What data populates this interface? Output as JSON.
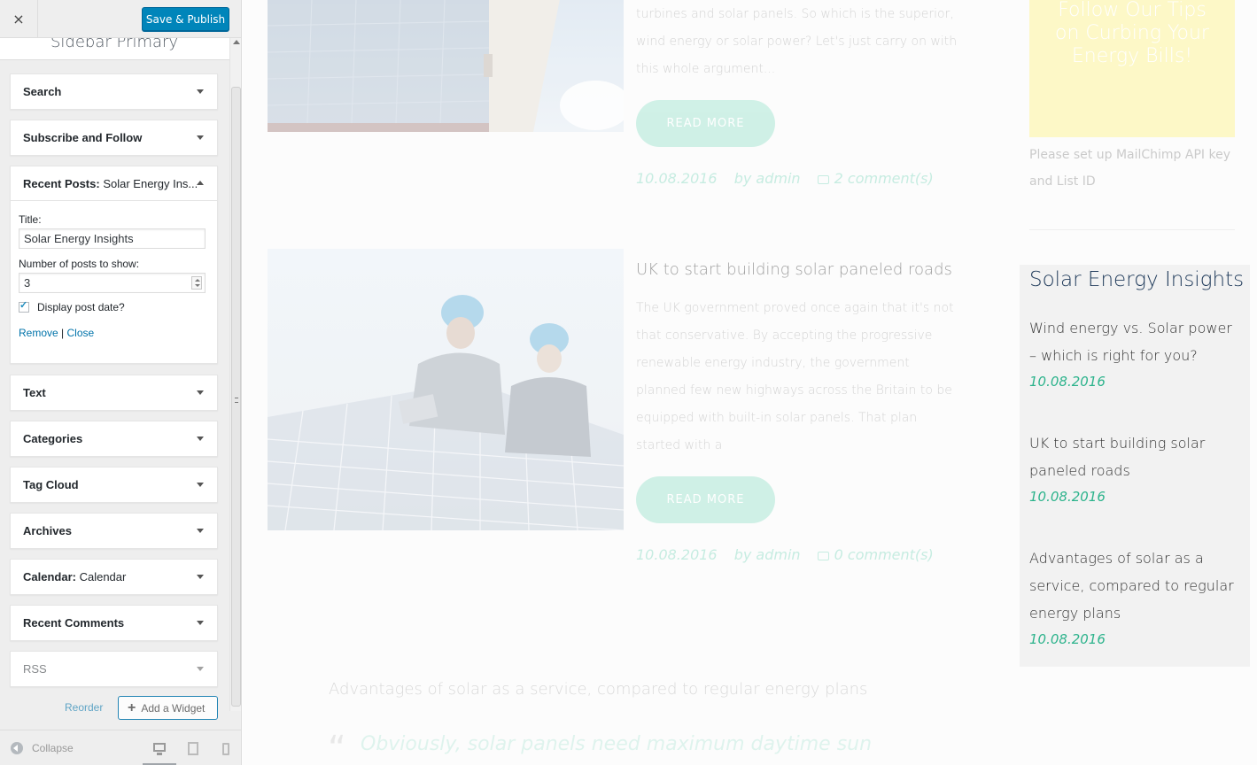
{
  "customizer": {
    "close_label": "×",
    "publish_label": "Save & Publish",
    "section_title": "Sidebar Primary",
    "widgets": [
      {
        "title": "Search",
        "subtitle": ""
      },
      {
        "title": "Subscribe and Follow",
        "subtitle": ""
      },
      {
        "title": "Recent Posts:",
        "subtitle": "Solar Energy Ins..."
      },
      {
        "title": "Text",
        "subtitle": ""
      },
      {
        "title": "Categories",
        "subtitle": ""
      },
      {
        "title": "Tag Cloud",
        "subtitle": ""
      },
      {
        "title": "Archives",
        "subtitle": ""
      },
      {
        "title": "Calendar:",
        "subtitle": "Calendar"
      },
      {
        "title": "Recent Comments",
        "subtitle": ""
      },
      {
        "title": "RSS",
        "subtitle": ""
      }
    ],
    "recent_posts_form": {
      "title_label": "Title:",
      "title_value": "Solar Energy Insights",
      "number_label": "Number of posts to show:",
      "number_value": "3",
      "display_date_label": "Display post date?",
      "display_date_checked": true,
      "remove_label": "Remove",
      "separator": "|",
      "close_label": "Close"
    },
    "reorder_label": "Reorder",
    "add_widget_label": "Add a Widget",
    "collapse_label": "Collapse"
  },
  "preview": {
    "post1": {
      "excerpt_lines": [
        "turbines and solar panels. So which is the superior,",
        "wind energy or solar power? Let's just carry on with",
        "this whole argument..."
      ],
      "read_more": "READ MORE",
      "date": "10.08.2016",
      "author": "by admin",
      "comments": "2 comment(s)"
    },
    "post2": {
      "title": "UK to start building solar paneled roads",
      "excerpt_lines": [
        "The UK government proved once again that it's not",
        "that conservative. By accepting the progressive",
        "renewable energy industry, the government",
        "planned few new highways across the Britain to be",
        "equipped with built-in solar panels. That plan",
        "started with a"
      ],
      "read_more": "READ MORE",
      "date": "10.08.2016",
      "author": "by admin",
      "comments": "0 comment(s)"
    },
    "promo_lines": [
      "Follow Our Tips",
      "on Curbing Your",
      "Energy Bills!"
    ],
    "mailchimp_msg": "Please set up MailChimp API key and List ID",
    "recent_posts_widget": {
      "title": "Solar Energy Insights",
      "posts": [
        {
          "title": "Wind energy vs. Solar power – which is right for you?",
          "date": "10.08.2016"
        },
        {
          "title": "UK to start building solar paneled roads",
          "date": "10.08.2016"
        },
        {
          "title": "Advantages of solar as a service, compared to regular energy plans",
          "date": "10.08.2016"
        }
      ]
    },
    "bottom_post_title": "Advantages of solar as a service, compared to regular energy plans",
    "bottom_quote_mark": "“",
    "bottom_quote": "Obviously, solar panels need maximum daytime sun",
    "colors": {
      "accent_green": "#2db38c",
      "sidebar_title": "#1f3a5a",
      "publish_button": "#0085ba",
      "promo_yellow": "#fdf8c7"
    }
  }
}
